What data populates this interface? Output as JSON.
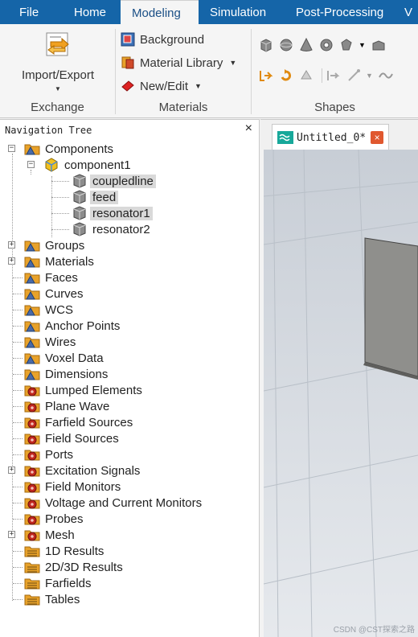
{
  "menu": {
    "tabs": [
      {
        "label": "File"
      },
      {
        "label": "Home"
      },
      {
        "label": "Modeling"
      },
      {
        "label": "Simulation"
      },
      {
        "label": "Post-Processing"
      },
      {
        "label": "V"
      }
    ],
    "active_tab": "Modeling"
  },
  "ribbon": {
    "exchange": {
      "import_export_label": "Import/Export",
      "group_label": "Exchange"
    },
    "materials": {
      "background_label": "Background",
      "material_library_label": "Material Library",
      "new_edit_label": "New/Edit",
      "group_label": "Materials"
    },
    "shapes": {
      "group_label": "Shapes"
    }
  },
  "nav": {
    "title": "Navigation Tree",
    "close": "×",
    "tree": {
      "components": "Components",
      "component1": "component1",
      "parts": [
        "coupledline",
        "feed",
        "resonator1",
        "resonator2"
      ],
      "items": [
        "Groups",
        "Materials",
        "Faces",
        "Curves",
        "WCS",
        "Anchor Points",
        "Wires",
        "Voxel Data",
        "Dimensions",
        "Lumped Elements",
        "Plane Wave",
        "Farfield Sources",
        "Field Sources",
        "Ports",
        "Excitation Signals",
        "Field Monitors",
        "Voltage and Current Monitors",
        "Probes",
        "Mesh",
        "1D Results",
        "2D/3D Results",
        "Farfields",
        "Tables"
      ]
    }
  },
  "document": {
    "tab_label": "Untitled_0*",
    "tab_close": "×"
  },
  "watermark": "CSDN @CST探索之路",
  "colors": {
    "menu_bar": "#1565a8",
    "selection": "#d9d9d9",
    "folder": "#e8a22a",
    "red_gear": "#c0261e",
    "tab_close": "#e0582f"
  }
}
